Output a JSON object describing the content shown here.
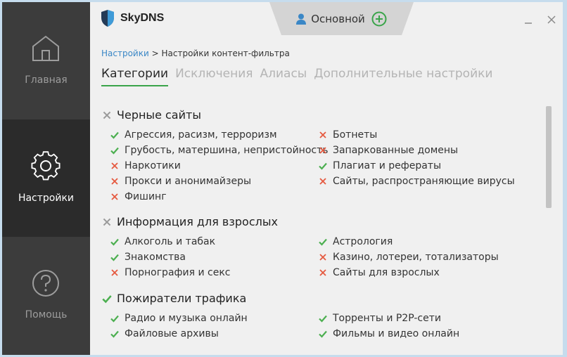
{
  "sidebar": {
    "items": [
      {
        "label": "Главная",
        "icon": "home-icon",
        "active": false
      },
      {
        "label": "Настройки",
        "icon": "gear-icon",
        "active": true
      },
      {
        "label": "Помощь",
        "icon": "help-icon",
        "active": false
      }
    ]
  },
  "header": {
    "logo_text": "SkyDNS",
    "profile_label": "Основной"
  },
  "breadcrumb": {
    "root": "Настройки",
    "separator": ">",
    "current": "Настройки контент-фильтра"
  },
  "tabs": [
    "Категории",
    "Исключения",
    "Алиасы",
    "Дополнительные настройки"
  ],
  "groups": [
    {
      "title": "Черные сайты",
      "allowed": false,
      "left": [
        {
          "label": "Агрессия, расизм, терроризм",
          "allowed": true
        },
        {
          "label": "Грубость, матершина, непристойность",
          "allowed": true
        },
        {
          "label": "Наркотики",
          "allowed": false
        },
        {
          "label": "Прокси и анонимайзеры",
          "allowed": false
        },
        {
          "label": "Фишинг",
          "allowed": false
        }
      ],
      "right": [
        {
          "label": "Ботнеты",
          "allowed": false
        },
        {
          "label": "Запаркованные домены",
          "allowed": false
        },
        {
          "label": "Плагиат и рефераты",
          "allowed": true
        },
        {
          "label": "Сайты, распространяющие вирусы",
          "allowed": false
        }
      ]
    },
    {
      "title": "Информация для взрослых",
      "allowed": false,
      "left": [
        {
          "label": "Алкоголь и табак",
          "allowed": true
        },
        {
          "label": "Знакомства",
          "allowed": true
        },
        {
          "label": "Порнография и секс",
          "allowed": false
        }
      ],
      "right": [
        {
          "label": "Астрология",
          "allowed": true
        },
        {
          "label": "Казино, лотереи, тотализаторы",
          "allowed": false
        },
        {
          "label": "Сайты для взрослых",
          "allowed": false
        }
      ]
    },
    {
      "title": "Пожиратели трафика",
      "allowed": true,
      "left": [
        {
          "label": "Радио и музыка онлайн",
          "allowed": true
        },
        {
          "label": "Файловые архивы",
          "allowed": true
        }
      ],
      "right": [
        {
          "label": "Торренты и P2P-сети",
          "allowed": true
        },
        {
          "label": "Фильмы и видео онлайн",
          "allowed": true
        }
      ]
    }
  ],
  "colors": {
    "check": "#4caf50",
    "cross_item": "#e5593f",
    "cross_group": "#9a9a9a",
    "accent": "#3aa44a",
    "link": "#3a87c6"
  }
}
